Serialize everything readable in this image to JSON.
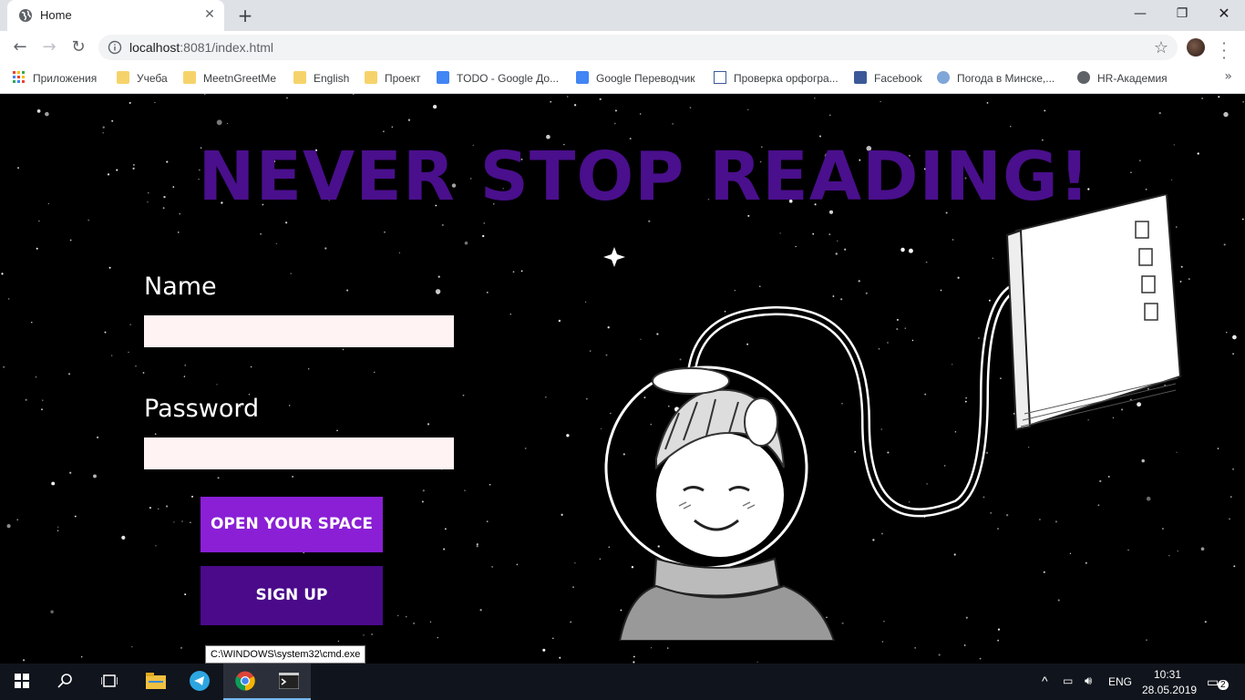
{
  "browser": {
    "tab_title": "Home",
    "url_host": "localhost",
    "url_rest": ":8081/index.html",
    "bookmarks": [
      {
        "label": "Приложения",
        "icon": "apps-grid-icon"
      },
      {
        "label": "Учеба",
        "icon": "folder-icon"
      },
      {
        "label": "MeetnGreetMe",
        "icon": "folder-icon"
      },
      {
        "label": "English",
        "icon": "folder-icon"
      },
      {
        "label": "Проект",
        "icon": "folder-icon"
      },
      {
        "label": "TODO - Google До...",
        "icon": "google-docs-icon"
      },
      {
        "label": "Google Переводчик",
        "icon": "google-translate-icon"
      },
      {
        "label": "Проверка орфогра...",
        "icon": "spellcheck-icon"
      },
      {
        "label": "Facebook",
        "icon": "facebook-icon"
      },
      {
        "label": "Погода в Минске,...",
        "icon": "weather-icon"
      },
      {
        "label": "HR-Академия",
        "icon": "globe-icon"
      }
    ]
  },
  "page": {
    "headline": "NEVER STOP READING!",
    "name_label": "Name",
    "password_label": "Password",
    "name_value": "",
    "password_value": "",
    "open_button": "OPEN YOUR SPACE",
    "signup_button": "SIGN UP",
    "colors": {
      "headline": "#4a0f8c",
      "open_button": "#8a1fd6",
      "signup_button": "#4a0a8a",
      "input_bg": "#fff3f3"
    }
  },
  "tooltip": "C:\\WINDOWS\\system32\\cmd.exe",
  "taskbar": {
    "language": "ENG",
    "time": "10:31",
    "date": "28.05.2019",
    "notifications": "2"
  }
}
